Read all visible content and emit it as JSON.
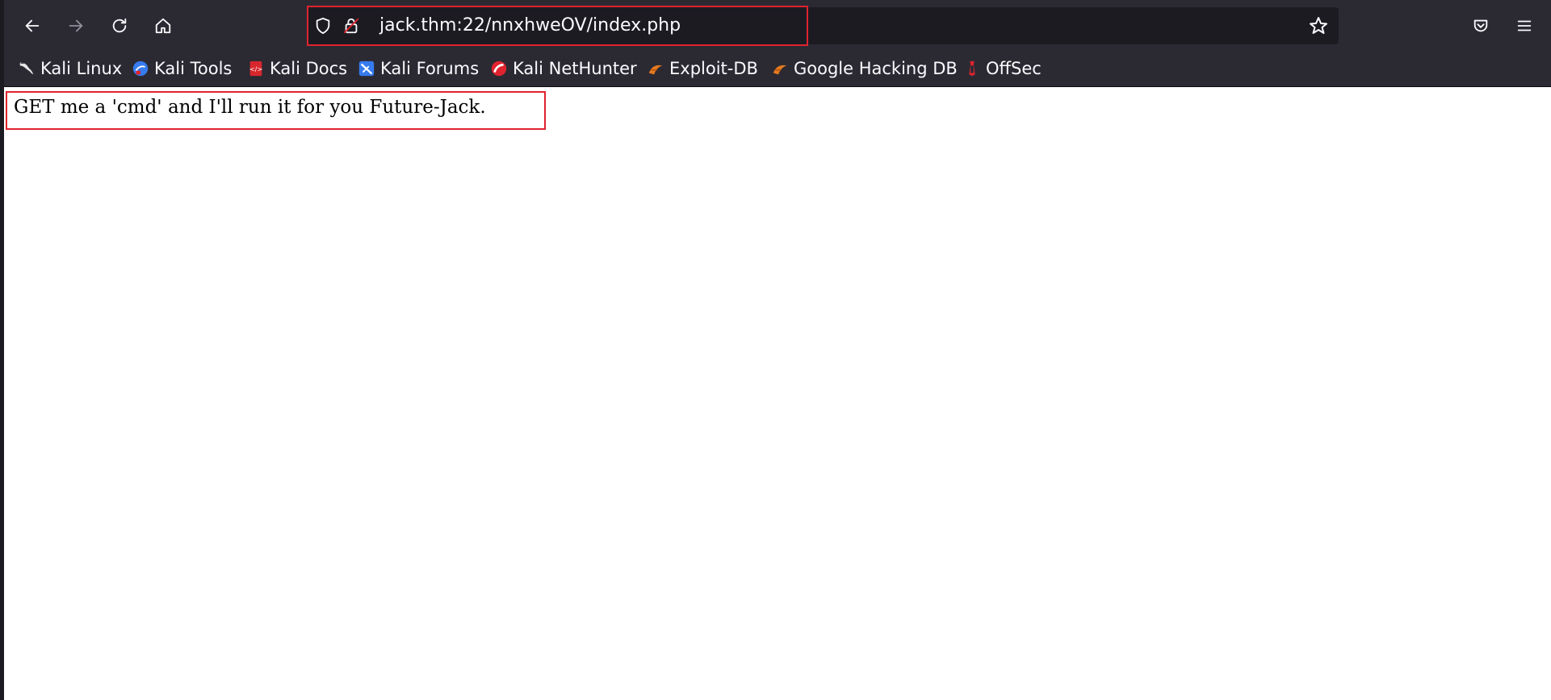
{
  "toolbar": {
    "back_icon": "back-arrow-icon",
    "forward_icon": "forward-arrow-icon",
    "reload_icon": "reload-icon",
    "home_icon": "home-icon",
    "pocket_icon": "pocket-icon",
    "menu_icon": "hamburger-menu-icon"
  },
  "url_bar": {
    "url": "jack.thm:22/nnxhweOV/index.php",
    "tracking_icon": "shield-icon",
    "insecure_icon": "insecure-lock-icon",
    "bookmark_icon": "star-icon"
  },
  "bookmarks": [
    {
      "label": "Kali Linux",
      "icon": "kali-dragon-icon"
    },
    {
      "label": "Kali Tools",
      "icon": "kali-tools-icon"
    },
    {
      "label": "Kali Docs",
      "icon": "kali-docs-icon"
    },
    {
      "label": "Kali Forums",
      "icon": "kali-forums-icon"
    },
    {
      "label": "Kali NetHunter",
      "icon": "nethunter-icon"
    },
    {
      "label": "Exploit-DB",
      "icon": "exploit-db-icon"
    },
    {
      "label": "Google Hacking DB",
      "icon": "ghdb-icon"
    },
    {
      "label": "OffSec",
      "icon": "offsec-icon"
    }
  ],
  "page": {
    "body_text": "GET me a 'cmd' and I'll run it for you Future-Jack."
  },
  "colors": {
    "toolbar_bg": "#2b2a33",
    "urlbar_bg": "#1c1b22",
    "highlight_red": "#e0232e",
    "toolbar_text": "#fbfbfe",
    "page_bg": "#ffffff"
  }
}
